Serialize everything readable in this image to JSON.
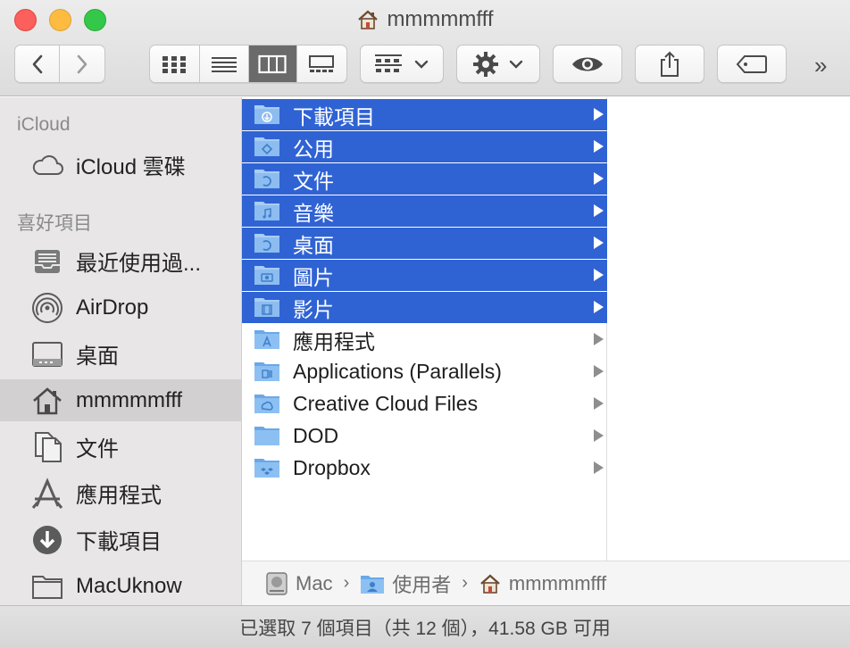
{
  "window": {
    "title": "mmmmmfff"
  },
  "toolbar": {
    "back_icon": "chevron-left-icon",
    "forward_icon": "chevron-right-icon",
    "view_modes": [
      "icon-view",
      "list-view",
      "column-view",
      "gallery-view"
    ],
    "active_view": "column-view",
    "group_icon": "group-grid-icon",
    "action_icon": "gear-icon",
    "quicklook_icon": "eye-icon",
    "share_icon": "share-icon",
    "tag_icon": "tag-icon",
    "more_label": "»"
  },
  "sidebar": {
    "sections": [
      {
        "header": "iCloud",
        "items": [
          {
            "label": "iCloud 雲碟",
            "icon": "cloud-icon"
          }
        ]
      },
      {
        "header": "喜好項目",
        "items": [
          {
            "label": "最近使用過...",
            "icon": "recents-icon"
          },
          {
            "label": "AirDrop",
            "icon": "airdrop-icon"
          },
          {
            "label": "桌面",
            "icon": "desktop-icon"
          },
          {
            "label": "mmmmmfff",
            "icon": "home-icon",
            "selected": true
          },
          {
            "label": "文件",
            "icon": "documents-icon"
          },
          {
            "label": "應用程式",
            "icon": "applications-icon"
          },
          {
            "label": "下載項目",
            "icon": "downloads-icon"
          },
          {
            "label": "MacUknow",
            "icon": "folder-icon"
          }
        ]
      }
    ]
  },
  "files": [
    {
      "name": "下載項目",
      "icon": "downloads-folder-icon",
      "selected": true
    },
    {
      "name": "公用",
      "icon": "public-folder-icon",
      "selected": true
    },
    {
      "name": "文件",
      "icon": "documents-folder-icon",
      "selected": true
    },
    {
      "name": "音樂",
      "icon": "music-folder-icon",
      "selected": true
    },
    {
      "name": "桌面",
      "icon": "desktop-folder-icon",
      "selected": true
    },
    {
      "name": "圖片",
      "icon": "pictures-folder-icon",
      "selected": true
    },
    {
      "name": "影片",
      "icon": "movies-folder-icon",
      "selected": true
    },
    {
      "name": "應用程式",
      "icon": "applications-folder-icon",
      "selected": false
    },
    {
      "name": "Applications (Parallels)",
      "icon": "parallels-folder-icon",
      "selected": false
    },
    {
      "name": "Creative Cloud Files",
      "icon": "creative-cloud-folder-icon",
      "selected": false
    },
    {
      "name": "DOD",
      "icon": "folder-icon",
      "selected": false
    },
    {
      "name": "Dropbox",
      "icon": "dropbox-folder-icon",
      "selected": false
    }
  ],
  "pathbar": {
    "crumbs": [
      {
        "label": "Mac",
        "icon": "disk-icon"
      },
      {
        "label": "使用者",
        "icon": "users-folder-icon"
      },
      {
        "label": "mmmmmfff",
        "icon": "home-icon"
      }
    ],
    "separator": "›"
  },
  "status": {
    "text": "已選取 7 個項目（共 12 個），41.58 GB 可用"
  },
  "colors": {
    "selection": "#2f63d4",
    "folder": "#6aa8e8",
    "sidebar_bg": "#e8e6e6",
    "icon_gray": "#5b5b5b"
  }
}
